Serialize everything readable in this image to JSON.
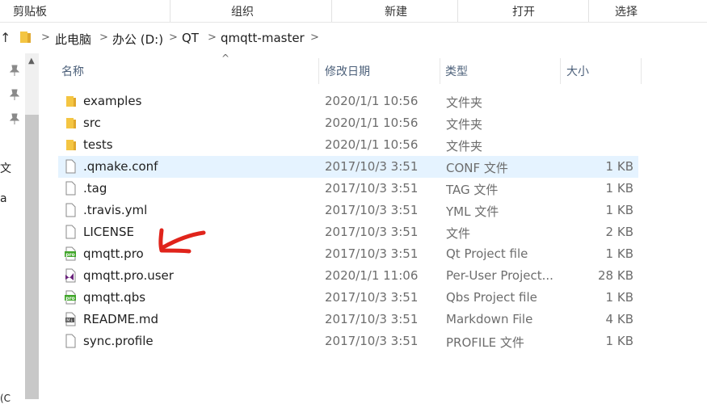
{
  "ribbon": {
    "groups": [
      "剪贴板",
      "组织",
      "新建",
      "打开",
      "选择"
    ]
  },
  "address": {
    "up_glyph": "↑",
    "crumbs": [
      "此电脑",
      "办公 (D:)",
      "QT",
      "qmqtt-master"
    ]
  },
  "nav": {
    "labels": [
      "文",
      "a",
      "(C"
    ]
  },
  "columns": {
    "name": "名称",
    "date": "修改日期",
    "type": "类型",
    "size": "大小"
  },
  "files": [
    {
      "name": "examples",
      "date": "2020/1/1 10:56",
      "type": "文件夹",
      "size": "",
      "icon": "folder-icon"
    },
    {
      "name": "src",
      "date": "2020/1/1 10:56",
      "type": "文件夹",
      "size": "",
      "icon": "folder-icon"
    },
    {
      "name": "tests",
      "date": "2020/1/1 10:56",
      "type": "文件夹",
      "size": "",
      "icon": "folder-icon"
    },
    {
      "name": ".qmake.conf",
      "date": "2017/10/3 3:51",
      "type": "CONF 文件",
      "size": "1 KB",
      "icon": "file-icon"
    },
    {
      "name": ".tag",
      "date": "2017/10/3 3:51",
      "type": "TAG 文件",
      "size": "1 KB",
      "icon": "file-icon"
    },
    {
      "name": ".travis.yml",
      "date": "2017/10/3 3:51",
      "type": "YML 文件",
      "size": "1 KB",
      "icon": "file-icon"
    },
    {
      "name": "LICENSE",
      "date": "2017/10/3 3:51",
      "type": "文件",
      "size": "2 KB",
      "icon": "file-icon"
    },
    {
      "name": "qmqtt.pro",
      "date": "2017/10/3 3:51",
      "type": "Qt Project file",
      "size": "1 KB",
      "icon": "qt-pro-icon"
    },
    {
      "name": "qmqtt.pro.user",
      "date": "2020/1/1 11:06",
      "type": "Per-User Project...",
      "size": "28 KB",
      "icon": "visual-studio-icon"
    },
    {
      "name": "qmqtt.qbs",
      "date": "2017/10/3 3:51",
      "type": "Qbs Project file",
      "size": "1 KB",
      "icon": "qt-pro-icon"
    },
    {
      "name": "README.md",
      "date": "2017/10/3 3:51",
      "type": "Markdown File",
      "size": "4 KB",
      "icon": "markdown-icon"
    },
    {
      "name": "sync.profile",
      "date": "2017/10/3 3:51",
      "type": "PROFILE 文件",
      "size": "1 KB",
      "icon": "file-icon"
    }
  ],
  "colors": {
    "selected_row": "#e5f3ff",
    "folder": "#f4c542",
    "annotation": "#e0241b",
    "qt_green": "#41a62a"
  }
}
